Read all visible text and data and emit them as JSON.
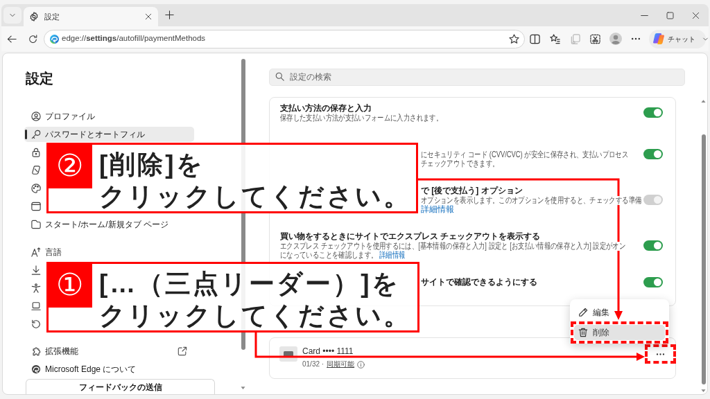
{
  "browser": {
    "tabs": [
      {
        "title": "設定",
        "selected": true
      }
    ],
    "address": "edge://**settings**/autofill/paymentMethods",
    "chat_button": "チャット"
  },
  "sidebar": {
    "title": "設定",
    "groups": [
      {
        "items": [
          {
            "label": "プロファイル",
            "selected": false
          },
          {
            "label": "パスワードとオートフィル",
            "selected": true
          },
          {
            "selected": false
          },
          {
            "selected": false
          },
          {
            "selected": false
          },
          {
            "selected": false
          },
          {
            "label": "スタート/ホーム/新規タブ ページ",
            "selected": false
          }
        ]
      },
      {
        "items": [
          {
            "label": "言語",
            "selected": false
          },
          {
            "selected": false
          },
          {
            "selected": false
          },
          {
            "selected": false
          },
          {
            "selected": false
          }
        ]
      },
      {
        "items": [
          {
            "label": "拡張機能",
            "selected": false,
            "external": true
          },
          {
            "label": "Microsoft Edge について",
            "selected": false,
            "external": false
          }
        ]
      }
    ],
    "feedback_button": "フィードバックの送信"
  },
  "search": {
    "placeholder": "設定の検索"
  },
  "settings_card": {
    "rows": [
      {
        "kind": "full",
        "title": "支払い方法の保存と入力",
        "lines": [
          {
            "text": "保存した支払い方法が支払いフォームに入力されます。"
          }
        ],
        "on": true,
        "disabled": false
      },
      {
        "kind": "covered",
        "lines": [
          {
            "text": "にセキュリティ コード (CVV/CVC) が安全に保存され、支払いプロセス"
          },
          {
            "text": "チェックアウトできます。"
          }
        ],
        "on": true,
        "disabled": false
      },
      {
        "kind": "covered",
        "title": "で [後で支払う] オプション",
        "lines": [
          {
            "text": "オプションを表示します。このオプションを使用すると、チェックする準備"
          },
          {
            "link": "詳細情報"
          }
        ],
        "on": true,
        "disabled": true
      },
      {
        "kind": "full",
        "title": "買い物をするときにサイトでエクスプレス チェックアウトを表示する",
        "lines": [
          {
            "text": "エクスプレス チェックアウトを使用するには、[基本情報の保存と入力] 設定と [お支払い情報の保存と入力] 設定がオン"
          },
          {
            "text": "になっていることを確認します。",
            "link": "詳細情報"
          }
        ],
        "on": true,
        "disabled": false
      },
      {
        "kind": "covered",
        "title": "サイトで確認できるようにする",
        "on": true,
        "disabled": false
      }
    ]
  },
  "payment_card": {
    "name": "Card •••• 1111",
    "expiry": "01/32 ·",
    "sync_link": "同期可能",
    "more_button": {
      "highlighted": true
    }
  },
  "context_menu": {
    "items": [
      {
        "label": "編集",
        "selected": false,
        "highlighted": false
      },
      {
        "label": "削除",
        "selected": true,
        "highlighted": true
      }
    ]
  },
  "annotations": {
    "callouts": [
      {
        "badge": "②",
        "lines": [
          "[削除]を",
          "クリックしてください。"
        ]
      },
      {
        "badge": "①",
        "lines": [
          "[…（三点リーダー）]を",
          "クリックしてください。"
        ]
      }
    ]
  }
}
